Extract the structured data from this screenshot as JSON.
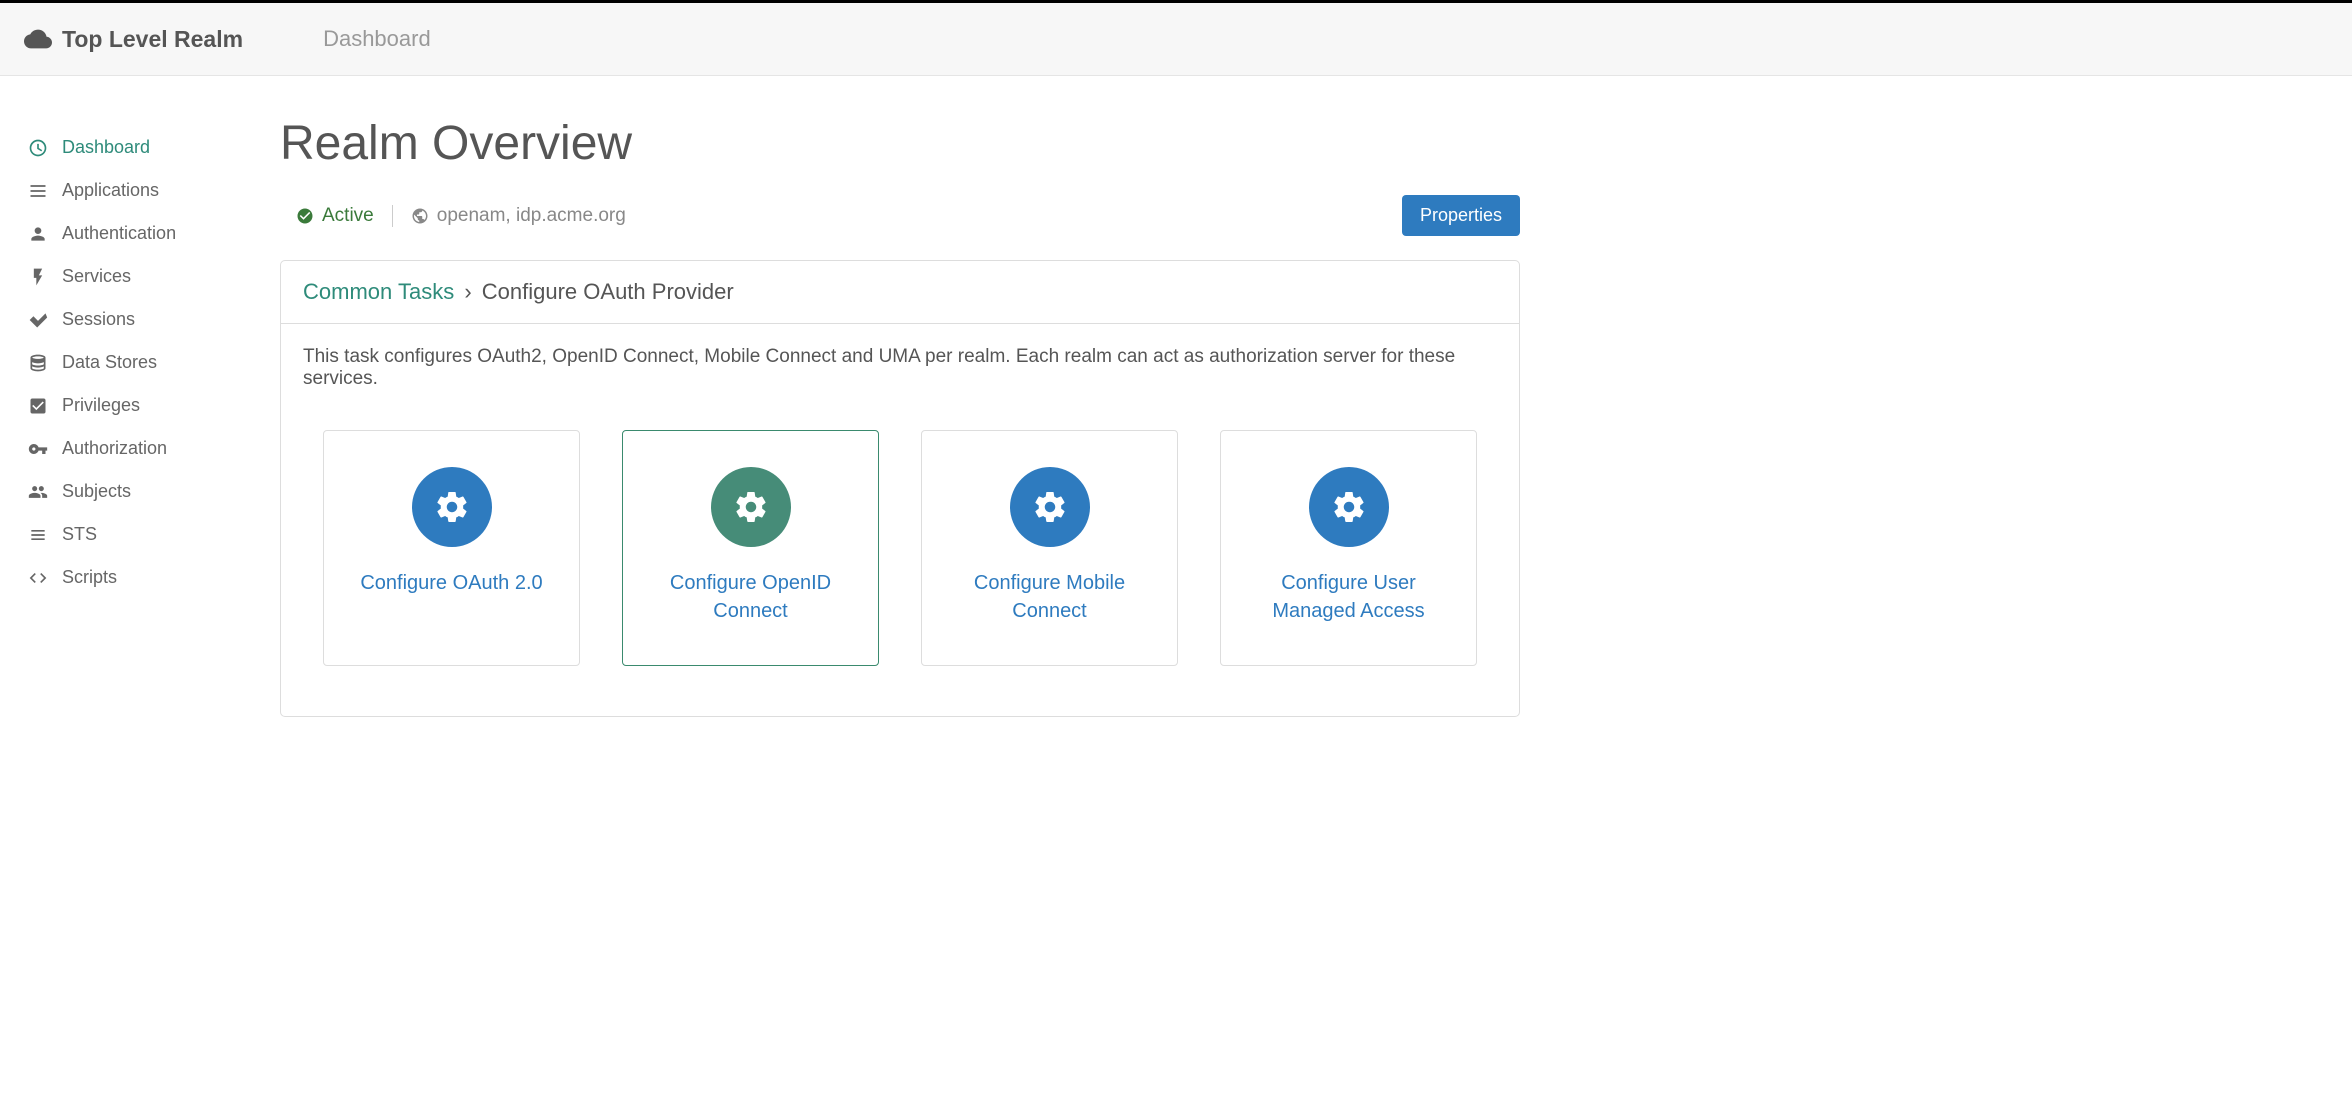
{
  "topbar": {
    "realm_name": "Top Level Realm",
    "breadcrumb": "Dashboard"
  },
  "sidebar": {
    "items": [
      {
        "label": "Dashboard",
        "icon": "dashboard",
        "active": true
      },
      {
        "label": "Applications",
        "icon": "applications",
        "active": false
      },
      {
        "label": "Authentication",
        "icon": "authentication",
        "active": false
      },
      {
        "label": "Services",
        "icon": "services",
        "active": false
      },
      {
        "label": "Sessions",
        "icon": "sessions",
        "active": false
      },
      {
        "label": "Data Stores",
        "icon": "datastores",
        "active": false
      },
      {
        "label": "Privileges",
        "icon": "privileges",
        "active": false
      },
      {
        "label": "Authorization",
        "icon": "authorization",
        "active": false
      },
      {
        "label": "Subjects",
        "icon": "subjects",
        "active": false
      },
      {
        "label": "STS",
        "icon": "sts",
        "active": false
      },
      {
        "label": "Scripts",
        "icon": "scripts",
        "active": false
      }
    ]
  },
  "main": {
    "title": "Realm Overview",
    "status": {
      "state": "Active",
      "domain": "openam, idp.acme.org"
    },
    "properties_button": "Properties",
    "panel": {
      "breadcrumb_root": "Common Tasks",
      "breadcrumb_current": "Configure OAuth Provider",
      "description": "This task configures OAuth2, OpenID Connect, Mobile Connect and UMA per realm. Each realm can act as authorization server for these services.",
      "tasks": [
        {
          "label": "Configure OAuth 2.0",
          "hover": false
        },
        {
          "label": "Configure OpenID Connect",
          "hover": true
        },
        {
          "label": "Configure Mobile Connect",
          "hover": false
        },
        {
          "label": "Configure User Managed Access",
          "hover": false
        }
      ]
    }
  }
}
